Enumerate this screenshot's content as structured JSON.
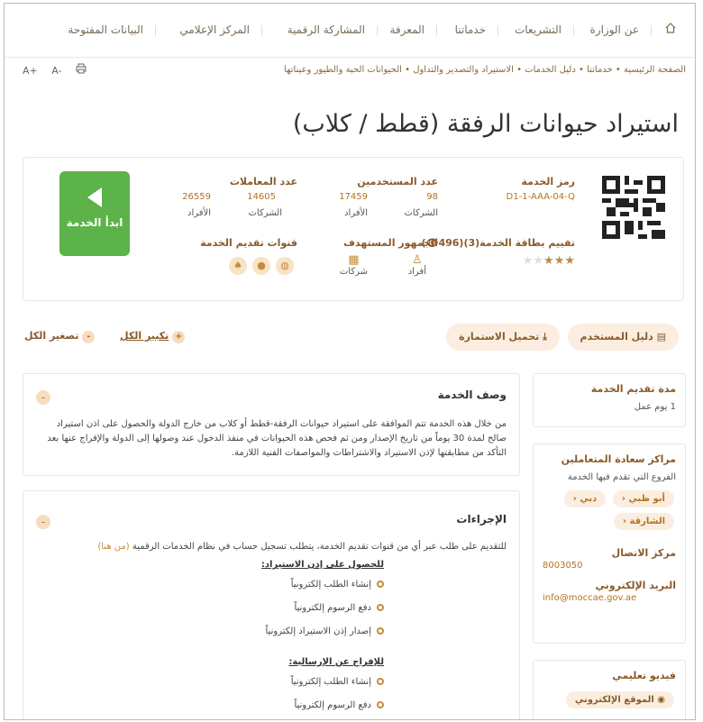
{
  "nav": {
    "home_icon": "home-icon",
    "items": [
      "عن الوزارة",
      "التشريعات",
      "خدماتنا",
      "المعرفة",
      "المشاركة الرقمية",
      "المركز الإعلامي",
      "البيانات المفتوحة"
    ]
  },
  "breadcrumb": {
    "items": [
      "الصفحة الرئيسية",
      "خدماتنا",
      "دليل الخدمات",
      "الاستيراد والتصدير والتداول",
      "الحيوانات الحية والطيور وعيناتها"
    ]
  },
  "tools": {
    "font_up": "A+",
    "font_down": "A-",
    "print_icon": "print-icon"
  },
  "page": {
    "title": "استيراد حيوانات الرفقة (قطط / كلاب)"
  },
  "service": {
    "code_label": "رمز الخدمة",
    "code_value": "D1-1-AAA-04-Q",
    "rating_label": "تقييم بطاقة الخدمة(3)(496",
    "rating_value": 3,
    "rating_max": 5,
    "users_label": "عدد المستخدمين",
    "users": {
      "companies_value": "98",
      "individuals_value": "17459",
      "companies_label": "الشركات",
      "individuals_label": "الأفراد"
    },
    "trans_label": "عدد المعاملات",
    "trans": {
      "companies_value": "14605",
      "individuals_value": "26559",
      "companies_label": "الشركات",
      "individuals_label": "الأفراد"
    },
    "audience_label": "الجمهور المستهدف",
    "audience": [
      "أفراد",
      "شركات"
    ],
    "channels_label": "قنوات تقديم الخدمة",
    "channels": [
      "globe-icon",
      "apple-icon",
      "android-icon"
    ],
    "start_label": "ابدأ الخدمة"
  },
  "actions": {
    "user_guide": "دليل المستخدم",
    "download_form": "تحميل الاستمارة",
    "expand_all": "تكبير الكل",
    "collapse_all": "تصغير الكل"
  },
  "sidebar": {
    "duration_title": "مدة تقديم الخدمة",
    "duration_value": "1 يوم عمل",
    "centers_title": "مراكز سعادة المتعاملين",
    "centers_sub": "الفروع التي تقدم فيها الخدمة",
    "branches": [
      "أبو ظبي",
      "دبي",
      "الشارقة"
    ],
    "contact_title": "مركز الاتصال",
    "contact_value": "8003050",
    "email_title": "البريد الإلكتروني",
    "email_value": "info@moccae.gov.ae",
    "video_title": "فيديو تعليمي",
    "video_link": "الموقع الإلكتروني"
  },
  "description": {
    "title": "وصف الخدمة",
    "text": "من خلال هذه الخدمة تتم الموافقة على استيراد حيوانات الرفقة-قطط أو كلاب من خارج الدولة والحصول على اذن استيراد صالح لمدة 30 يوماً من تاريخ الإصدار ومن ثم فحص هذه الحيوانات في منفذ الدخول عند وصولها إلى الدولة والإفراج عنها بعد التأكد من مطابقتها لإذن الاستيراد والاشتراطات والمواصفات الفنية اللازمة."
  },
  "procedures": {
    "title": "الإجراءات",
    "intro": "للتقديم على طلب عبر أي من قنوات تقديم الخدمة، يتطلب تسجيل حساب في نظام الخدمات الرقمية",
    "intro_link": "(من هنا)",
    "group1_title": "للحصول على إذن الاستيراد:",
    "group1": [
      "إنشاء الطلب إلكترونياً",
      "دفع الرسوم إلكترونياً",
      "إصدار إذن الاستيراد إلكترونياً"
    ],
    "group2_title": "للإفراج عن الإرسالية:",
    "group2": [
      "إنشاء الطلب إلكترونياً",
      "دفع الرسوم إلكترونياً"
    ]
  }
}
